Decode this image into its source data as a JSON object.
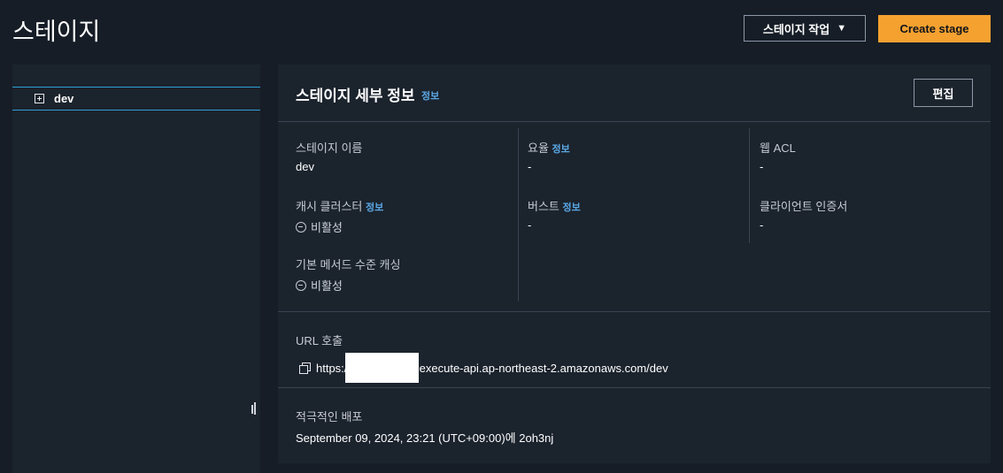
{
  "page": {
    "title": "스테이지"
  },
  "header": {
    "actions_label": "스테이지 작업",
    "create_label": "Create stage"
  },
  "tree": {
    "items": [
      {
        "label": "dev"
      }
    ]
  },
  "details": {
    "title": "스테이지 세부 정보",
    "info": "정보",
    "edit_label": "편집",
    "fields": {
      "stage_name": {
        "label": "스테이지 이름",
        "value": "dev"
      },
      "cache_cluster": {
        "label": "캐시 클러스터",
        "value": "비활성"
      },
      "default_method_cache": {
        "label": "기본 메서드 수준 캐싱",
        "value": "비활성"
      },
      "rate": {
        "label": "요율",
        "value": "-"
      },
      "burst": {
        "label": "버스트",
        "value": "-"
      },
      "web_acl": {
        "label": "웹 ACL",
        "value": "-"
      },
      "client_cert": {
        "label": "클라이언트 인증서",
        "value": "-"
      }
    },
    "invoke_url": {
      "label": "URL 호출",
      "prefix": "https://",
      "suffix": ".execute-api.ap-northeast-2.amazonaws.com/dev"
    },
    "active_deployment": {
      "label": "적극적인 배포",
      "value": "September 09, 2024, 23:21 (UTC+09:00)에 2oh3nj"
    }
  },
  "colors": {
    "accent": "#f5a130",
    "link": "#5aa8e4",
    "selected_border": "#2ea0d6"
  }
}
